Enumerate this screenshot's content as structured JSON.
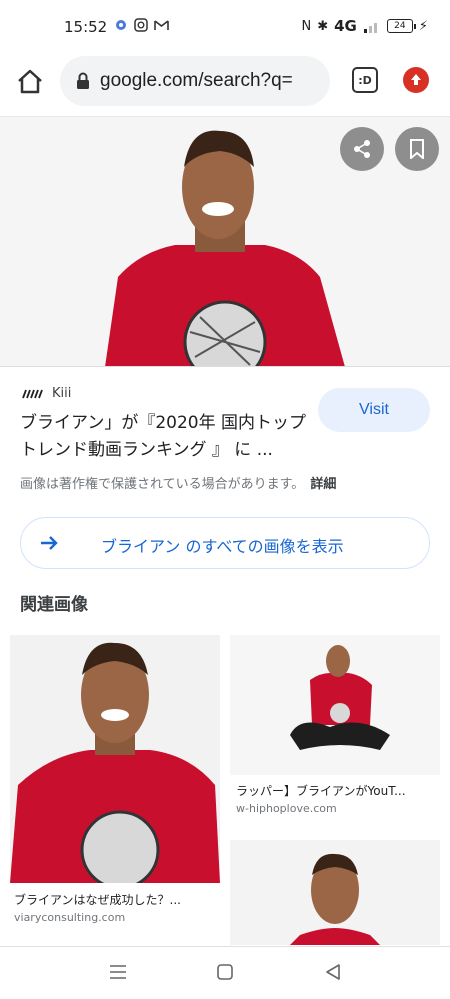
{
  "status_bar": {
    "time": "15:52",
    "network": "4G",
    "battery": "24"
  },
  "browser": {
    "url": "google.com/search?q=",
    "tab_label": ":D"
  },
  "image_viewer": {
    "source_name": "Kiii",
    "title": "ブライアン」が『2020年 国内トップトレンド動画ランキング 』 に ...",
    "visit_label": "Visit",
    "copyright_notice": "画像は著作権で保護されている場合があります。",
    "details_label": "詳細",
    "all_images_label": "ブライアン のすべての画像を表示",
    "related_heading": "関連画像"
  },
  "related": [
    {
      "caption": "ブライアンはなぜ成功した？...",
      "source": "viaryconsulting.com"
    },
    {
      "caption": "ラッパー】ブライアンがYouT...",
      "source": "w-hiphoplove.com"
    }
  ],
  "colors": {
    "accent": "#1967d2",
    "visit_bg": "#e8f0fe",
    "shirt": "#c8102e"
  }
}
